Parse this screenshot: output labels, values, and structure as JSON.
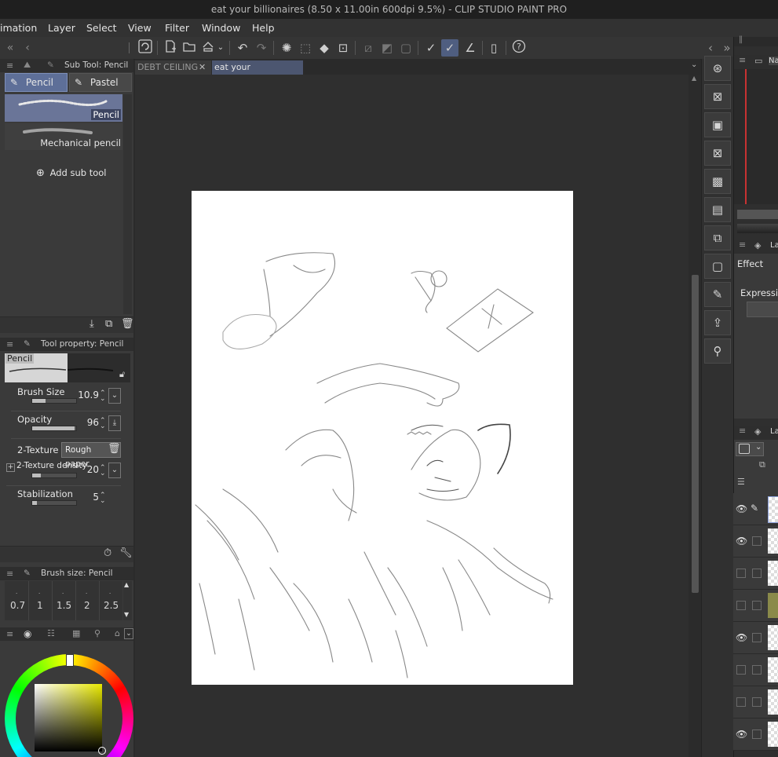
{
  "window": {
    "title": "eat your billionaires (8.50 x 11.00in 600dpi 9.5%) - CLIP STUDIO PAINT PRO"
  },
  "menu": [
    "imation",
    "Layer",
    "Select",
    "View",
    "Filter",
    "Window",
    "Help"
  ],
  "toolbar": {
    "nav_prev": "‹",
    "nav_next": "‹",
    "right_prev": "‹",
    "right_next": "»"
  },
  "subtool": {
    "header": "Sub Tool: Pencil",
    "tabs": [
      "Pencil",
      "Pastel"
    ],
    "items": [
      {
        "label": "Pencil",
        "selected": true
      },
      {
        "label": "Mechanical pencil",
        "selected": false
      }
    ],
    "add_label": "Add sub tool"
  },
  "toolprop": {
    "header": "Tool property: Pencil",
    "preview_label": "Pencil",
    "rows": [
      {
        "label": "Brush Size",
        "value": "10.9",
        "fill": 0.3
      },
      {
        "label": "Opacity",
        "value": "96",
        "fill": 0.96
      },
      {
        "label": "2-Texture",
        "button": "Rough paper"
      },
      {
        "label": "2-Texture density",
        "value": "20",
        "fill": 0.2
      },
      {
        "label": "Stabilization",
        "value": "5",
        "fill": 0.1
      }
    ]
  },
  "brushsize": {
    "header": "Brush size: Pencil",
    "sizes": [
      "0.7",
      "1",
      "1.5",
      "2",
      "2.5"
    ]
  },
  "documents": {
    "tabs": [
      {
        "label": "DEBT CEILING Pi",
        "active": false
      },
      {
        "label": "eat your billionaires",
        "active": true
      }
    ]
  },
  "rightpanel": {
    "navigator_tab": "Na",
    "layerprop_tab": "La",
    "effect_label": "Effect",
    "expression_label": "Expressior",
    "layers_tab": "La"
  },
  "layers": [
    {
      "visible": true
    },
    {
      "visible": true
    },
    {
      "visible": false
    },
    {
      "visible": false
    },
    {
      "visible": true
    },
    {
      "visible": false
    },
    {
      "visible": false
    },
    {
      "visible": true
    }
  ],
  "colors": {
    "accent": "#5e6f98",
    "canvas_bg": "#2f2f2f",
    "paper": "#ffffff"
  }
}
